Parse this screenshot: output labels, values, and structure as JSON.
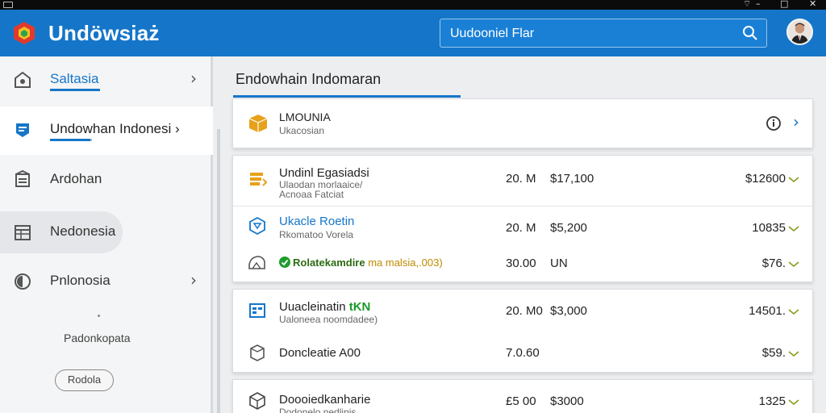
{
  "app": {
    "title": "Undöwsiaż",
    "search_placeholder": "Uudooniel Flar"
  },
  "sidebar": {
    "items": [
      {
        "label": "Saltasia",
        "icon": "home-icon",
        "chevron": "›"
      },
      {
        "label": "Undowhan  Indonesi ›",
        "icon": "tag-icon",
        "chevron": ""
      },
      {
        "label": "Ardohan",
        "icon": "document-icon",
        "chevron": ""
      },
      {
        "label": "Nedonesia",
        "icon": "grid-icon",
        "chevron": ""
      },
      {
        "label": "Pnlonosia",
        "icon": "clock-icon",
        "chevron": "›"
      }
    ],
    "sub_label": "Padonkopata",
    "button_label": "Rodola"
  },
  "main": {
    "title": "Endowhain  Indomaran",
    "header_card": {
      "title": "LMOUNIA",
      "subtitle": "Ukacosian",
      "icon": "box-icon",
      "action_icon": "info-icon",
      "chevron": "›"
    },
    "orders": [
      {
        "title": "Undinl Egasiadsi",
        "subtitle": "Ulaodan morlaaice/\nAcnoaa Fatciat",
        "qty": "20. M",
        "price": "$17,100",
        "total": "$12600",
        "icon": "stack-icon"
      },
      {
        "title": "Ukacle Roetin",
        "subtitle": "Rkomatoo Vorela",
        "qty": "20. M",
        "price": "$5,200",
        "total": "10835",
        "icon": "cube-outline-icon"
      },
      {
        "title_main": "Rolatekamdire",
        "title_extra": " ma malsia,.003)",
        "qty": "30.00",
        "price": "UN",
        "total": "$76.",
        "icon": "tag-outline-icon"
      },
      {
        "title_main": "Uuacleinatin ",
        "title_tag": "tKN",
        "subtitle": "Ualoneea noomdadee)",
        "qty": "20. M0",
        "price": "$3,000",
        "total": "14501.",
        "icon": "table-icon"
      },
      {
        "title": "Doncleatie A00",
        "qty": "7.0.60",
        "price": "",
        "total": "$59.",
        "icon": "box-outline-icon"
      },
      {
        "title": "Doooiedkanharie",
        "subtitle": "Dodonelo nedlinis",
        "qty": "£5  00",
        "price": "$3000",
        "total": "1325",
        "icon": "cube-icon"
      }
    ]
  },
  "colors": {
    "primary": "#1576c9",
    "header_icon_orange": "#e8a11b",
    "success_green": "#1f9e2e",
    "tick_olive": "#8a9a1a"
  }
}
